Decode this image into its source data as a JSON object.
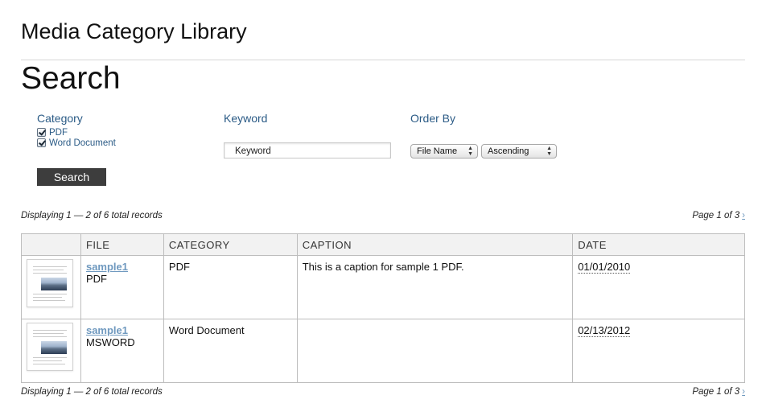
{
  "site_title": "Media Category Library",
  "page_title": "Search",
  "filters": {
    "category_label": "Category",
    "categories": [
      {
        "label": "PDF",
        "checked": true
      },
      {
        "label": "Word Document",
        "checked": true
      }
    ],
    "keyword_label": "Keyword",
    "keyword_placeholder": "Keyword",
    "order_by_label": "Order By",
    "order_field": "File Name",
    "order_direction": "Ascending",
    "search_button": "Search"
  },
  "pagination": {
    "displaying": "Displaying 1 — 2 of 6 total records",
    "page": "Page 1 of 3",
    "next": "›"
  },
  "table": {
    "columns": [
      "",
      "FILE",
      "CATEGORY",
      "CAPTION",
      "DATE"
    ],
    "rows": [
      {
        "file_name": "sample1",
        "file_type": "PDF",
        "category": "PDF",
        "caption": "This is a caption for sample 1 PDF.",
        "date": "01/01/2010"
      },
      {
        "file_name": "sample1",
        "file_type": "MSWORD",
        "category": "Word Document",
        "caption": "",
        "date": "02/13/2012"
      }
    ]
  },
  "colors": {
    "label_blue": "#2b5b86",
    "link_blue": "#6f99bf",
    "button_bg": "#3d3d3d"
  }
}
